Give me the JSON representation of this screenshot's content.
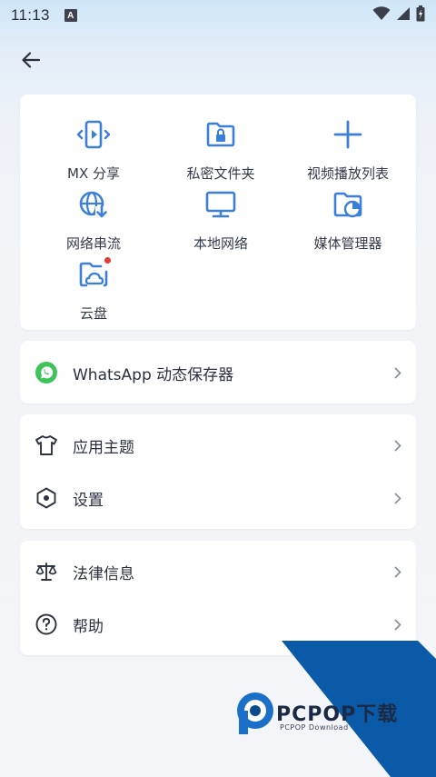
{
  "status_bar": {
    "time": "11:13",
    "notif_letter": "A"
  },
  "grid": [
    {
      "label": "MX 分享",
      "icon": "mx-share-icon"
    },
    {
      "label": "私密文件夹",
      "icon": "private-folder-icon"
    },
    {
      "label": "视频播放列表",
      "icon": "add-playlist-icon"
    },
    {
      "label": "网络串流",
      "icon": "network-stream-icon"
    },
    {
      "label": "本地网络",
      "icon": "local-network-icon"
    },
    {
      "label": "媒体管理器",
      "icon": "media-manager-icon"
    },
    {
      "label": "云盘",
      "icon": "cloud-drive-icon",
      "badge": true
    }
  ],
  "whatsapp": {
    "label": "WhatsApp 动态保存器"
  },
  "settings_group": [
    {
      "label": "应用主题",
      "icon": "shirt-icon"
    },
    {
      "label": "设置",
      "icon": "settings-hexagon-icon"
    }
  ],
  "info_group": [
    {
      "label": "法律信息",
      "icon": "scale-icon"
    },
    {
      "label": "帮助",
      "icon": "help-icon"
    }
  ],
  "watermark": {
    "brand": "PCPOP下载",
    "sub": "PCPOP Download"
  },
  "colors": {
    "accent": "#3b7fd9",
    "whatsapp": "#3ec35a",
    "watermark_blue": "#0a5aa8"
  }
}
